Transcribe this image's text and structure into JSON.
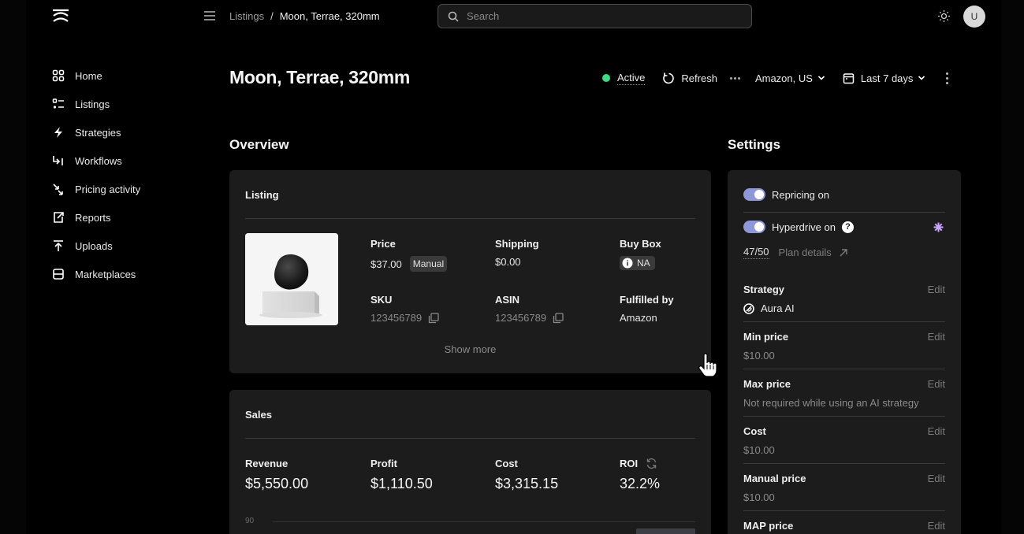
{
  "header": {
    "breadcrumb": {
      "parent": "Listings",
      "separator": "/",
      "current": "Moon, Terrae, 320mm"
    },
    "search_placeholder": "Search",
    "avatar_initial": "U"
  },
  "sidebar": {
    "items": [
      {
        "label": "Home",
        "icon": "grid-icon"
      },
      {
        "label": "Listings",
        "icon": "list-icon"
      },
      {
        "label": "Strategies",
        "icon": "bolt-icon"
      },
      {
        "label": "Workflows",
        "icon": "workflow-icon"
      },
      {
        "label": "Pricing activity",
        "icon": "pricing-activity-icon"
      },
      {
        "label": "Reports",
        "icon": "report-icon"
      },
      {
        "label": "Uploads",
        "icon": "upload-icon"
      },
      {
        "label": "Marketplaces",
        "icon": "store-icon"
      }
    ]
  },
  "page": {
    "title": "Moon, Terrae, 320mm",
    "status": "Active",
    "refresh_label": "Refresh",
    "marketplace": "Amazon, US",
    "date_range": "Last 7 days"
  },
  "overview": {
    "title": "Overview",
    "listing": {
      "title": "Listing",
      "price_label": "Price",
      "price_value": "$37.00",
      "price_badge": "Manual",
      "shipping_label": "Shipping",
      "shipping_value": "$0.00",
      "buybox_label": "Buy Box",
      "buybox_value": "NA",
      "sku_label": "SKU",
      "sku_value": "123456789",
      "asin_label": "ASIN",
      "asin_value": "123456789",
      "fulfilled_label": "Fulfilled by",
      "fulfilled_value": "Amazon",
      "show_more": "Show more"
    },
    "sales": {
      "title": "Sales",
      "revenue_label": "Revenue",
      "revenue_value": "$5,550.00",
      "profit_label": "Profit",
      "profit_value": "$1,110.50",
      "cost_label": "Cost",
      "cost_value": "$3,315.15",
      "roi_label": "ROI",
      "roi_value": "32.2%",
      "chart_tick": "90"
    }
  },
  "settings": {
    "title": "Settings",
    "repricing_label": "Repricing on",
    "hyperdrive_label": "Hyperdrive on",
    "plan_usage": "47/50",
    "plan_details": "Plan details",
    "edit_label": "Edit",
    "strategy_label": "Strategy",
    "strategy_value": "Aura AI",
    "min_price_label": "Min price",
    "min_price_value": "$10.00",
    "max_price_label": "Max price",
    "max_price_value": "Not required while using an AI strategy",
    "cost_label": "Cost",
    "cost_value": "$10.00",
    "manual_price_label": "Manual price",
    "manual_price_value": "$10.00",
    "map_price_label": "MAP price"
  },
  "colors": {
    "status_active": "#3ddc84",
    "toggle_on": "#8e98d8",
    "hyperdrive_accent": "#c9a6ff",
    "card_bg": "#1c1c1c"
  }
}
